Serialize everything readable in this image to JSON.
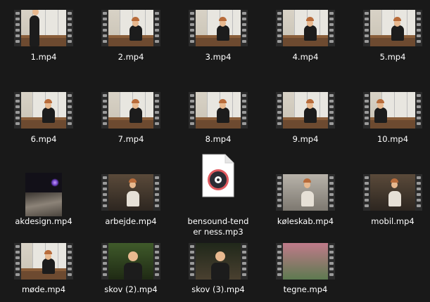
{
  "files": [
    {
      "name": "1.mp4",
      "kind": "video",
      "scene": "room-closeup"
    },
    {
      "name": "2.mp4",
      "kind": "video",
      "scene": "room"
    },
    {
      "name": "3.mp4",
      "kind": "video",
      "scene": "room"
    },
    {
      "name": "4.mp4",
      "kind": "video",
      "scene": "room"
    },
    {
      "name": "5.mp4",
      "kind": "video",
      "scene": "room"
    },
    {
      "name": "6.mp4",
      "kind": "video",
      "scene": "room"
    },
    {
      "name": "7.mp4",
      "kind": "video",
      "scene": "room"
    },
    {
      "name": "8.mp4",
      "kind": "video",
      "scene": "room"
    },
    {
      "name": "9.mp4",
      "kind": "video",
      "scene": "room"
    },
    {
      "name": "10.mp4",
      "kind": "video",
      "scene": "room-left"
    },
    {
      "name": "akdesign.mp4",
      "kind": "video-portrait",
      "scene": "dark"
    },
    {
      "name": "arbejde.mp4",
      "kind": "video",
      "scene": "desk"
    },
    {
      "name": "bensound-tenderness.mp3",
      "display": "bensound-tender ness.mp3",
      "kind": "audio",
      "icon": "audio-file-icon"
    },
    {
      "name": "køleskab.mp4",
      "kind": "video",
      "scene": "kitchen"
    },
    {
      "name": "mobil.mp4",
      "kind": "video",
      "scene": "desk"
    },
    {
      "name": "møde.mp4",
      "kind": "video",
      "scene": "room"
    },
    {
      "name": "skov (2).mp4",
      "kind": "video",
      "scene": "green"
    },
    {
      "name": "skov (3).mp4",
      "kind": "video",
      "scene": "night"
    },
    {
      "name": "tegne.mp4",
      "kind": "video",
      "scene": "flowers"
    }
  ],
  "colors": {
    "background": "#191919",
    "text": "#ffffff",
    "filmstrip": "#2e2e2e",
    "audio_ring": "#e05a60"
  }
}
